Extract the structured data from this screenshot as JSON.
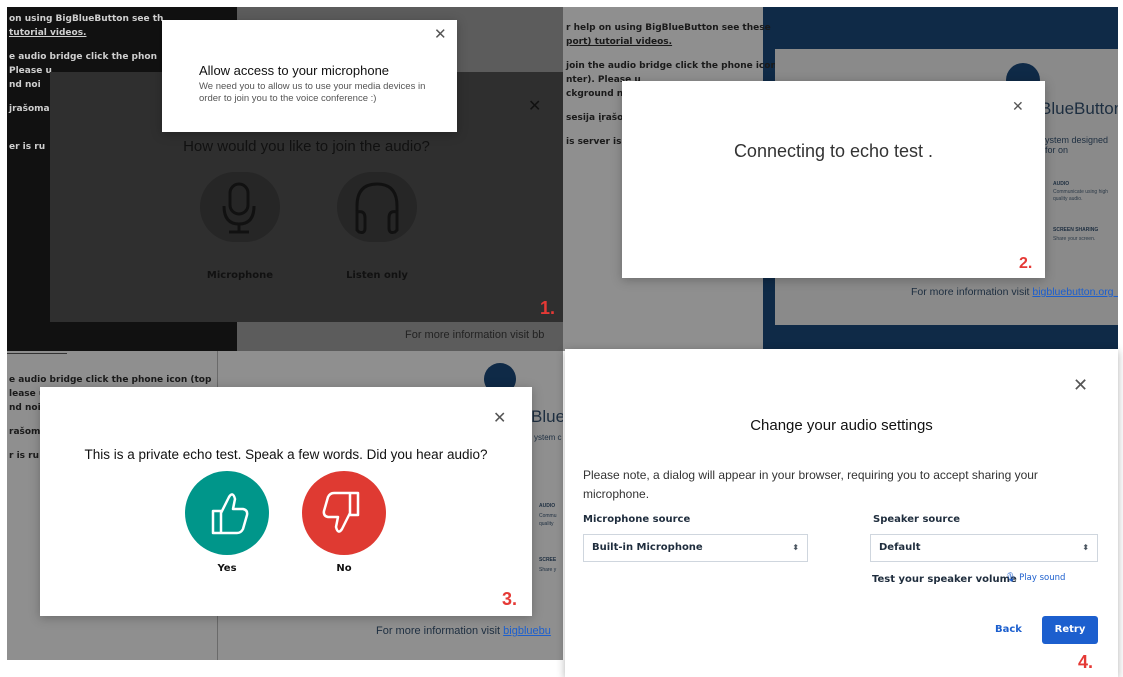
{
  "panel1": {
    "bg_lines": [
      "on using BigBlueButton see th",
      "tutorial videos.",
      "e audio bridge click the phon",
      "Please u",
      "nd noi",
      "jrašoma",
      "er is ru"
    ],
    "footer_text": "For more information visit bb",
    "permission": {
      "title": "Allow access to your microphone",
      "body": "We need you to allow us to use your media devices in order to join you to the voice conference :)"
    },
    "join_title": "How would you like to join the audio?",
    "microphone_label": "Microphone",
    "listen_label": "Listen only",
    "step": "1."
  },
  "panel2": {
    "bg_lines": [
      "r help on using BigBlueButton see these",
      "port) tutorial videos.",
      "join the audio bridge click the phone icon (top",
      "nter). Please u",
      "ckground noi",
      "sesija įrašoma",
      "is server is ru"
    ],
    "brand_partial": "BlueButton",
    "brand_sub": "ystem designed for on",
    "features": [
      {
        "title": "AUDIO",
        "desc": "Communicate using high quality audio."
      },
      {
        "title": "SCREEN SHARING",
        "desc": "Share your screen."
      }
    ],
    "footer_text": "For more information visit",
    "footer_link": "bigbluebutton.org →",
    "message": "Connecting to echo test .",
    "step": "2."
  },
  "panel3": {
    "bg_lines": [
      "e audio bridge click the phone icon (top",
      "lease u",
      "nd noi",
      "rašoma",
      "r is ru"
    ],
    "brand_partial": "Blue",
    "brand_sub": "ystem c",
    "side_labels": [
      "AUDIO",
      "Commu",
      "quality",
      "SCREE",
      "Share y"
    ],
    "footer_text": "For more information visit",
    "footer_link": "bigbluebu",
    "question": "This is a private echo test. Speak a few words. Did you hear audio?",
    "yes_label": "Yes",
    "no_label": "No",
    "step": "3."
  },
  "panel4": {
    "title": "Change your audio settings",
    "note": "Please note, a dialog will appear in your browser, requiring you to accept sharing your microphone.",
    "mic_source_label": "Microphone source",
    "mic_source_value": "Built-in Microphone",
    "speaker_source_label": "Speaker source",
    "speaker_source_value": "Default",
    "test_volume_label": "Test your speaker volume",
    "play_sound_label": "Play sound",
    "back_label": "Back",
    "retry_label": "Retry",
    "step": "4."
  },
  "colors": {
    "accent_blue": "#1c5fce",
    "yes_green": "#00968a",
    "no_red": "#df3a32",
    "step_red": "#e53935",
    "navy": "#0f2a47"
  }
}
